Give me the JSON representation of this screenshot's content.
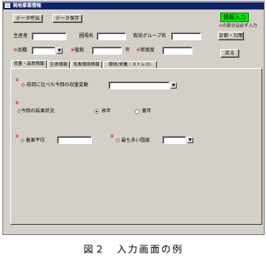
{
  "window": {
    "title": "現地事業情報"
  },
  "toolbar": {
    "data_read_label": "データ呼出",
    "data_save_label": "データ保存"
  },
  "status": {
    "badge": "情報入力",
    "required_mark": "※",
    "required_note": "の部分は必ず入力"
  },
  "header_fields": {
    "row1": [
      {
        "label": "生産者",
        "value": ""
      },
      {
        "label": "圃場名",
        "value": ""
      },
      {
        "label": "栽培グループ名",
        "value": ""
      }
    ],
    "row2": {
      "variety_label": "品種",
      "variety_value": "",
      "planting_label": "植栽",
      "planting_value": "",
      "planting_unit": "年",
      "density_label": "密度度",
      "density_value": ""
    }
  },
  "side_buttons": {
    "diagnose_label": "診断・対策",
    "back_label": "戻る"
  },
  "tabs": [
    {
      "label": "収量・品質情報",
      "active": true
    },
    {
      "label": "生体情報",
      "active": false
    },
    {
      "label": "気象環境情報",
      "active": false
    },
    {
      "label": "樹体(栄養・ストレス)",
      "active": false
    }
  ],
  "panel": {
    "q1": {
      "label": "◇ 前回に比べた今回の収量変動",
      "value": ""
    },
    "q2": {
      "label": "◇今回の結果状況",
      "options": [
        "表年",
        "裏年"
      ],
      "selected": "表年"
    },
    "q3": {
      "label": "◇ 着果平均",
      "value": ""
    },
    "q4": {
      "label": "○ 最も多い階級",
      "value": ""
    }
  },
  "caption": "図２　入力画面の例",
  "icons": {
    "dropdown": "chevron-down-icon",
    "window": "window-icon"
  },
  "colors": {
    "titlebar": "#10246a",
    "badge": "#00ee00",
    "required": "#d00000"
  }
}
